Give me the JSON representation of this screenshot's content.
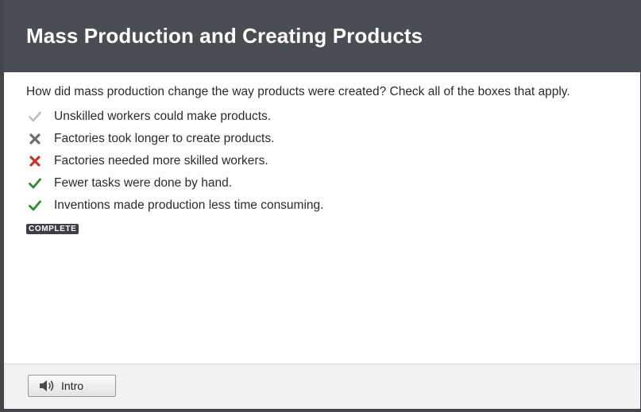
{
  "header": {
    "title": "Mass Production and Creating Products"
  },
  "question": {
    "text": "How did mass production change the way products were created? Check all of the boxes that apply."
  },
  "answers": [
    {
      "text": "Unskilled workers could make products.",
      "mark": "check-light-icon",
      "color": "#b9b9b9"
    },
    {
      "text": "Factories took longer to create products.",
      "mark": "x-gray-icon",
      "color": "#6d6d6d"
    },
    {
      "text": "Factories needed more skilled workers.",
      "mark": "x-red-icon",
      "color": "#c0392b"
    },
    {
      "text": "Fewer tasks were done by hand.",
      "mark": "check-green-icon",
      "color": "#2e8b2e"
    },
    {
      "text": "Inventions made production less time consuming.",
      "mark": "check-green-icon",
      "color": "#2e8b2e"
    }
  ],
  "status": {
    "badge": "COMPLETE"
  },
  "footer": {
    "intro_label": "Intro",
    "intro_icon": "speaker-icon"
  },
  "colors": {
    "header_bg": "#4b4d55",
    "badge_bg": "#3e3f45"
  }
}
